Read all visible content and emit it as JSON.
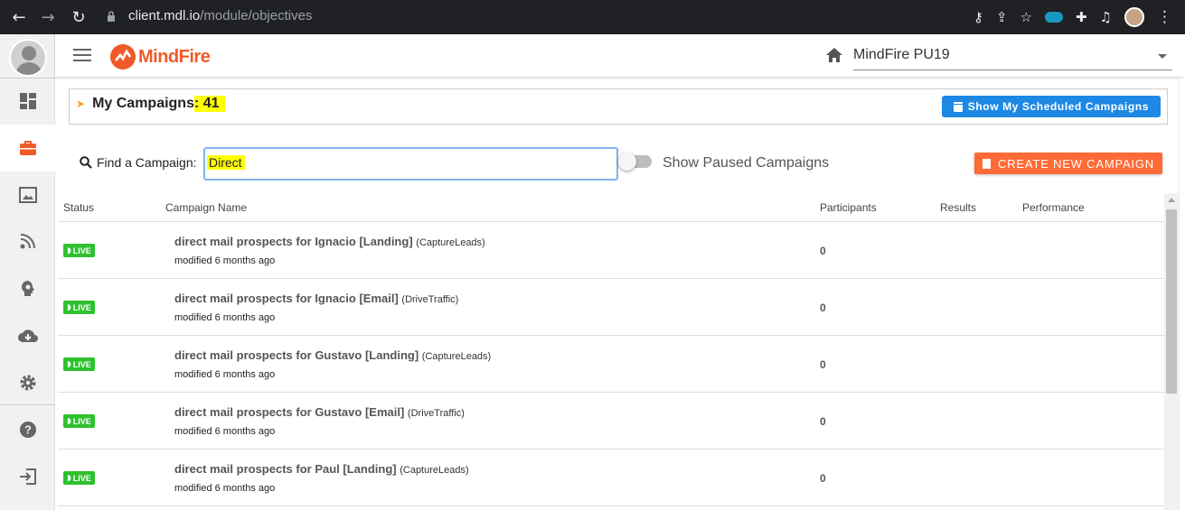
{
  "browser": {
    "url_host": "client.mdl.io",
    "url_path": "/module/objectives",
    "icons": [
      "back-arrow-icon",
      "forward-arrow-icon",
      "reload-icon",
      "lock-icon",
      "key-icon",
      "share-icon",
      "star-icon",
      "salesforce-icon",
      "extensions-icon",
      "media-icon",
      "profile-icon",
      "menu-icon"
    ]
  },
  "header": {
    "logo_text": "MindFire",
    "organization": "MindFire PU19"
  },
  "sidebar": {
    "items": [
      "avatar",
      "dashboard-icon",
      "briefcase-icon",
      "image-gallery-icon",
      "signal-icon",
      "lightbulb-head-icon",
      "cloud-download-icon",
      "gear-icon",
      "help-icon",
      "logout-icon"
    ],
    "active": "briefcase-icon"
  },
  "campaigns": {
    "title": "My Campaigns",
    "count_text": ": 41",
    "scheduled_button": "Show My Scheduled Campaigns",
    "find_label": "Find a Campaign:",
    "search_value": "Direct",
    "paused_label": "Show Paused Campaigns",
    "create_button": "CREATE NEW CAMPAIGN"
  },
  "table": {
    "headers": {
      "status": "Status",
      "name": "Campaign Name",
      "participants": "Participants",
      "results": "Results",
      "performance": "Performance"
    },
    "rows": [
      {
        "status": "LIVE",
        "name": "direct mail prospects for Ignacio [Landing]",
        "type": "(CaptureLeads)",
        "modified": "modified 6 months ago",
        "participants": "0"
      },
      {
        "status": "LIVE",
        "name": "direct mail prospects for Ignacio [Email]",
        "type": "(DriveTraffic)",
        "modified": "modified 6 months ago",
        "participants": "0"
      },
      {
        "status": "LIVE",
        "name": "direct mail prospects for Gustavo [Landing]",
        "type": "(CaptureLeads)",
        "modified": "modified 6 months ago",
        "participants": "0"
      },
      {
        "status": "LIVE",
        "name": "direct mail prospects for Gustavo [Email]",
        "type": "(DriveTraffic)",
        "modified": "modified 6 months ago",
        "participants": "0"
      },
      {
        "status": "LIVE",
        "name": "direct mail prospects for Paul [Landing]",
        "type": "(CaptureLeads)",
        "modified": "modified 6 months ago",
        "participants": "0"
      }
    ]
  },
  "colors": {
    "brand": "#f05a28",
    "primary_button": "#1e88e5",
    "create_button": "#ff6b35",
    "live_badge": "#2ec12e",
    "highlight": "#ffff00"
  }
}
